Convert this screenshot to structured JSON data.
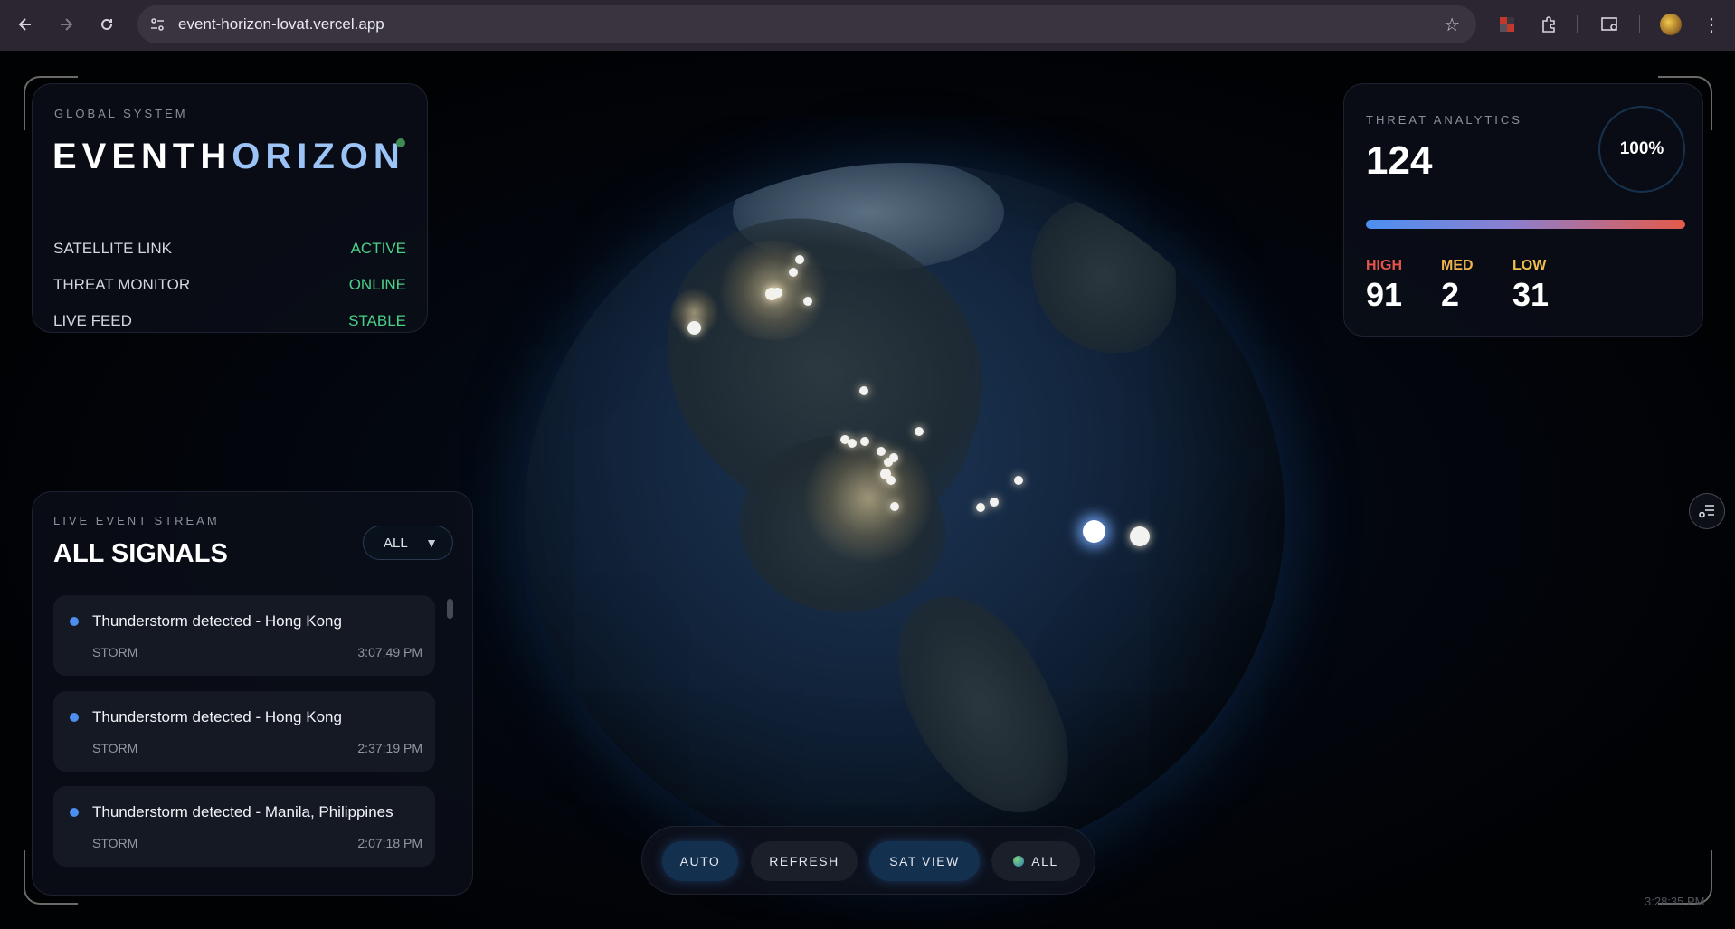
{
  "browser": {
    "url": "event-horizon-lovat.vercel.app"
  },
  "system": {
    "label": "GLOBAL SYSTEM",
    "brand_a": "EVENTH",
    "brand_b": "ORIZON",
    "rows": [
      {
        "key": "SATELLITE LINK",
        "value": "ACTIVE"
      },
      {
        "key": "THREAT MONITOR",
        "value": "ONLINE"
      },
      {
        "key": "LIVE FEED",
        "value": "STABLE"
      }
    ]
  },
  "threat": {
    "label": "THREAT ANALYTICS",
    "total": "124",
    "ring_percent": "100%",
    "levels": [
      {
        "label": "HIGH",
        "value": "91",
        "color": "#e5534b"
      },
      {
        "label": "MED",
        "value": "2",
        "color": "#f0b44c"
      },
      {
        "label": "LOW",
        "value": "31",
        "color": "#f0c04c"
      }
    ]
  },
  "stream": {
    "label": "LIVE EVENT STREAM",
    "title": "ALL SIGNALS",
    "filter": "ALL",
    "events": [
      {
        "title": "Thunderstorm detected - Hong Kong",
        "type": "STORM",
        "time": "3:07:49 PM"
      },
      {
        "title": "Thunderstorm detected - Hong Kong",
        "type": "STORM",
        "time": "2:37:19 PM"
      },
      {
        "title": "Thunderstorm detected - Manila, Philippines",
        "type": "STORM",
        "time": "2:07:18 PM"
      }
    ]
  },
  "controls": {
    "auto": "AUTO",
    "refresh": "REFRESH",
    "sat_view": "SAT VIEW",
    "all": "ALL"
  },
  "clock": "3:28:35 PM",
  "colors": {
    "accent_blue": "#4c8ff0",
    "status_green": "#4bd08a",
    "brand_light_blue": "#9cc3f5"
  }
}
